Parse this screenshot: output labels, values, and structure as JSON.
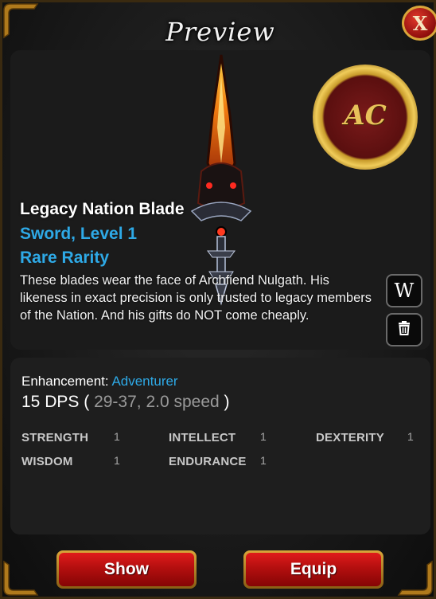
{
  "window": {
    "title": "Preview",
    "close_label": "X"
  },
  "item": {
    "name": "Legacy Nation Blade",
    "type_level": "Sword, Level 1",
    "rarity": "Rare Rarity",
    "description": "These blades wear the face of Archfiend Nulgath. His likeness in exact precision is only trusted to legacy members of the Nation. And his gifts do NOT come cheaply."
  },
  "emblem": {
    "text": "AC"
  },
  "side_buttons": {
    "wiki_label": "W",
    "trash_icon": "trash-icon"
  },
  "stats_panel": {
    "enhancement_label": "Enhancement:",
    "enhancement_value": "Adventurer",
    "dps_main": "15 DPS",
    "dps_open": "(",
    "dps_detail": "29-37, 2.0 speed",
    "dps_close": ")",
    "stats": [
      {
        "name": "STRENGTH",
        "value": "1"
      },
      {
        "name": "INTELLECT",
        "value": "1"
      },
      {
        "name": "DEXTERITY",
        "value": "1"
      },
      {
        "name": "WISDOM",
        "value": "1"
      },
      {
        "name": "ENDURANCE",
        "value": "1"
      }
    ]
  },
  "buttons": {
    "show_label": "Show",
    "equip_label": "Equip"
  },
  "colors": {
    "accent_blue": "#2ea9e6",
    "button_red": "#b30f0f",
    "gold_trim": "#d9a53a"
  }
}
